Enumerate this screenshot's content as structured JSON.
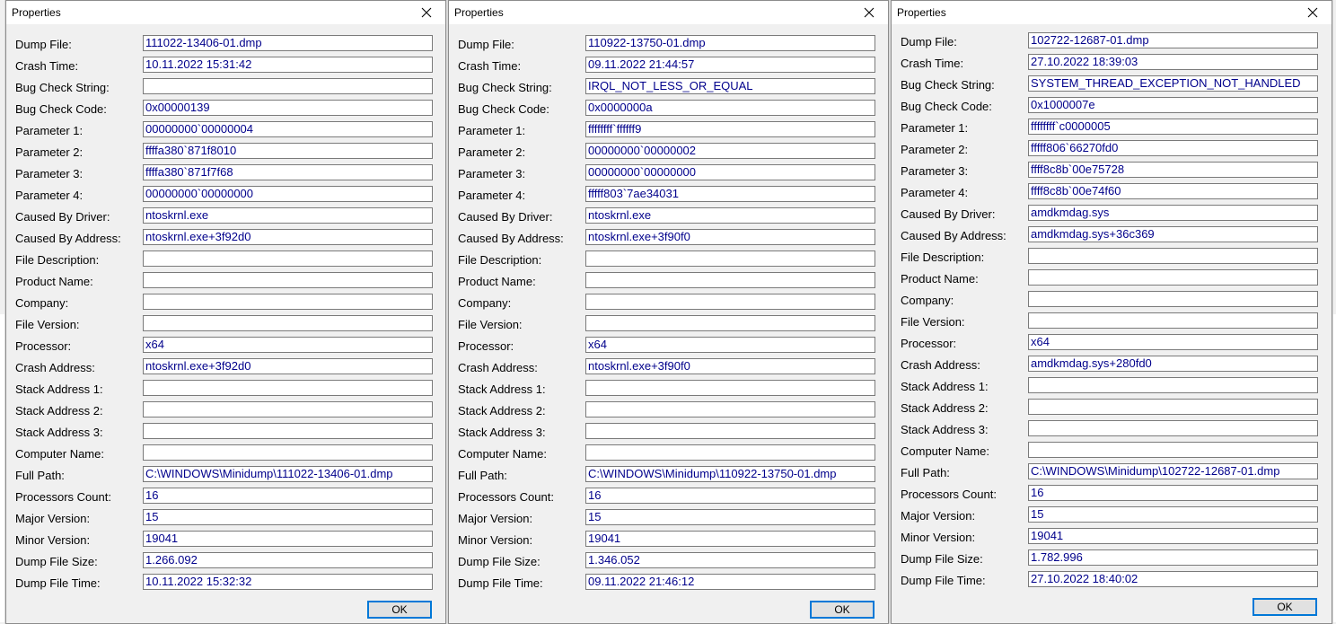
{
  "labels": [
    "Dump File:",
    "Crash Time:",
    "Bug Check String:",
    "Bug Check Code:",
    "Parameter 1:",
    "Parameter 2:",
    "Parameter 3:",
    "Parameter 4:",
    "Caused By Driver:",
    "Caused By Address:",
    "File Description:",
    "Product Name:",
    "Company:",
    "File Version:",
    "Processor:",
    "Crash Address:",
    "Stack Address 1:",
    "Stack Address 2:",
    "Stack Address 3:",
    "Computer Name:",
    "Full Path:",
    "Processors Count:",
    "Major Version:",
    "Minor Version:",
    "Dump File Size:",
    "Dump File Time:"
  ],
  "dialogs": [
    {
      "title": "Properties",
      "ok_label": "OK",
      "values": [
        "111022-13406-01.dmp",
        "10.11.2022 15:31:42",
        "",
        "0x00000139",
        "00000000`00000004",
        "ffffa380`871f8010",
        "ffffa380`871f7f68",
        "00000000`00000000",
        "ntoskrnl.exe",
        "ntoskrnl.exe+3f92d0",
        "",
        "",
        "",
        "",
        "x64",
        "ntoskrnl.exe+3f92d0",
        "",
        "",
        "",
        "",
        "C:\\WINDOWS\\Minidump\\111022-13406-01.dmp",
        "16",
        "15",
        "19041",
        "1.266.092",
        "10.11.2022 15:32:32"
      ]
    },
    {
      "title": "Properties",
      "ok_label": "OK",
      "values": [
        "110922-13750-01.dmp",
        "09.11.2022 21:44:57",
        "IRQL_NOT_LESS_OR_EQUAL",
        "0x0000000a",
        "ffffffff`ffffff9",
        "00000000`00000002",
        "00000000`00000000",
        "fffff803`7ae34031",
        "ntoskrnl.exe",
        "ntoskrnl.exe+3f90f0",
        "",
        "",
        "",
        "",
        "x64",
        "ntoskrnl.exe+3f90f0",
        "",
        "",
        "",
        "",
        "C:\\WINDOWS\\Minidump\\110922-13750-01.dmp",
        "16",
        "15",
        "19041",
        "1.346.052",
        "09.11.2022 21:46:12"
      ]
    },
    {
      "title": "Properties",
      "ok_label": "OK",
      "values": [
        "102722-12687-01.dmp",
        "27.10.2022 18:39:03",
        "SYSTEM_THREAD_EXCEPTION_NOT_HANDLED",
        "0x1000007e",
        "ffffffff`c0000005",
        "fffff806`66270fd0",
        "ffff8c8b`00e75728",
        "ffff8c8b`00e74f60",
        "amdkmdag.sys",
        "amdkmdag.sys+36c369",
        "",
        "",
        "",
        "",
        "x64",
        "amdkmdag.sys+280fd0",
        "",
        "",
        "",
        "",
        "C:\\WINDOWS\\Minidump\\102722-12687-01.dmp",
        "16",
        "15",
        "19041",
        "1.782.996",
        "27.10.2022 18:40:02"
      ]
    }
  ],
  "icons": {
    "close": "close-icon"
  },
  "colors": {
    "field_text": "#00008b",
    "ok_border": "#0078d7"
  }
}
